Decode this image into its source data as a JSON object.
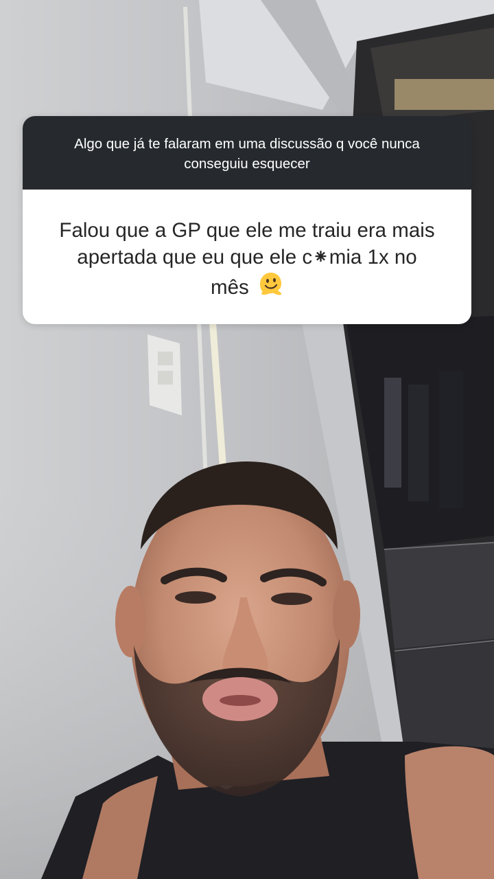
{
  "question_sticker": {
    "question": "Algo que já te falaram em uma discussão q você nunca conseguiu esquecer",
    "answer_line1": "Falou que a GP que ele me traiu era mais",
    "answer_line2": "apertada que eu que ele c⁕mia 1x no",
    "answer_line3": "mês",
    "answer_emoji": "melting-face-emoji"
  },
  "background": {
    "description_icon": "selfie-video-frame"
  },
  "colors": {
    "question_bg": "#262a2e",
    "question_text": "#ffffff",
    "answer_bg": "#ffffff",
    "answer_text": "#262626",
    "emoji_yellow": "#ffc83d"
  }
}
